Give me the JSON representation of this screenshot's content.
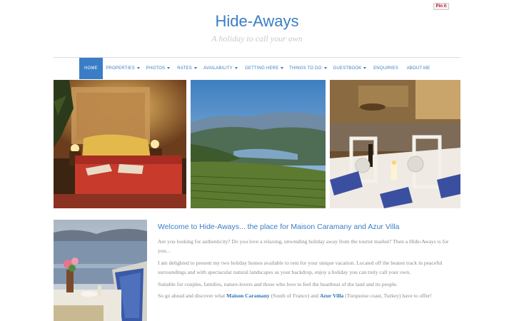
{
  "pinit": {
    "label": "Pin it"
  },
  "header": {
    "title": "Hide-Aways",
    "tagline": "A holiday to call your own"
  },
  "nav": {
    "items": [
      {
        "label": "HOME",
        "dropdown": false,
        "active": true
      },
      {
        "label": "PROPERTIES",
        "dropdown": true
      },
      {
        "label": "PHOTOS",
        "dropdown": true
      },
      {
        "label": "RATES",
        "dropdown": true
      },
      {
        "label": "AVAILABILITY",
        "dropdown": true
      },
      {
        "label": "GETTING HERE",
        "dropdown": true
      },
      {
        "label": "THINGS TO DO",
        "dropdown": true
      },
      {
        "label": "GUESTBOOK",
        "dropdown": true
      },
      {
        "label": "ENQUIRIES",
        "dropdown": false
      },
      {
        "label": "ABOUT ME",
        "dropdown": false
      }
    ]
  },
  "gallery": {
    "images": [
      "bedroom-photo",
      "vineyard-valley-photo",
      "dining-table-photo"
    ]
  },
  "content": {
    "heading": "Welcome to Hide-Aways... the place for Maison Caramany and Azur Villa",
    "p1": "Are you looking for authenticity?  Do you love a relaxing, unwinding holiday away from the tourist market?  Then a Hide-Aways is for you...",
    "p2": "I am delighted to present my two holiday homes available to rent for your unique vacation.  Located off the beaten track in peaceful surroundings and with spectacular natural landscapes as your backdrop, enjoy a holiday you can truly call your own.",
    "p3": "Suitable for couples, families, nature-lovers and those who love to feel the heartbeat of the land and its people.",
    "p4_before": "So go ahead and discover what ",
    "p4_link1": "Maison Caramany",
    "p4_mid": " (South of France) and ",
    "p4_link2": "Azur Villa",
    "p4_after": " (Turquoise coast, Turkey) have to offer!"
  },
  "colors": {
    "accent": "#3a7dc6",
    "text": "#8a8a8a",
    "tagline": "#c9c9c9"
  }
}
